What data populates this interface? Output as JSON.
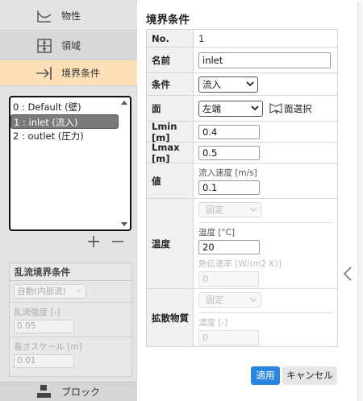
{
  "nav": {
    "properties": "物性",
    "region": "領域",
    "boundary": "境界条件",
    "block": "ブロック"
  },
  "bc_list": {
    "items": [
      {
        "label": "0 : Default (壁)",
        "selected": false
      },
      {
        "label": "1 : inlet (流入)",
        "selected": true
      },
      {
        "label": "2 : outlet (圧力)",
        "selected": false
      }
    ]
  },
  "turbulence": {
    "header": "乱流境界条件",
    "mode_value": "自動(内部流)",
    "intensity_label": "乱流強度 [-]",
    "intensity_value": "0.05",
    "length_label": "長さスケール [m]",
    "length_value": "0.01"
  },
  "panel": {
    "title": "境界条件",
    "no_label": "No.",
    "no_value": "1",
    "name_label": "名前",
    "name_value": "inlet",
    "condition_label": "条件",
    "condition_value": "流入",
    "face_label": "面",
    "face_value": "左端",
    "face_select_button": "面選択",
    "lmin_label": "Lmin [m]",
    "lmin_value": "0.4",
    "lmax_label": "Lmax [m]",
    "lmax_value": "0.5",
    "value_label": "値",
    "inflow_speed_label": "流入速度 [m/s]",
    "inflow_speed_value": "0.1",
    "temp_label": "温度",
    "temp_mode_value": "固定",
    "temperature_label": "温度 [°C]",
    "temperature_value": "20",
    "htc_label": "熱伝達率 [W/(m2 K)]",
    "htc_value": "0",
    "diffusion_label": "拡散物質",
    "diffusion_mode_value": "固定",
    "concentration_label": "濃度 [-]",
    "concentration_value": "0"
  },
  "buttons": {
    "apply": "適用",
    "cancel": "キャンセル"
  },
  "colors": {
    "active_nav": "#fde0b7",
    "apply_button": "#2a86e0",
    "list_selection": "#7a7a7a"
  }
}
